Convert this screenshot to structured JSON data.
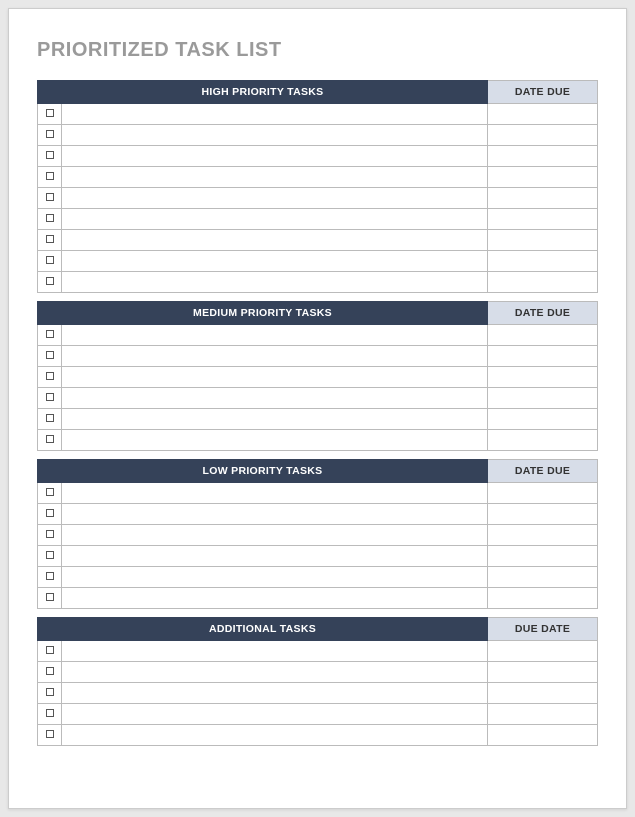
{
  "title": "PRIORITIZED TASK LIST",
  "sections": [
    {
      "header_tasks": "HIGH PRIORITY TASKS",
      "header_date": "DATE DUE",
      "rows": [
        "",
        "",
        "",
        "",
        "",
        "",
        "",
        "",
        ""
      ]
    },
    {
      "header_tasks": "MEDIUM PRIORITY TASKS",
      "header_date": "DATE DUE",
      "rows": [
        "",
        "",
        "",
        "",
        "",
        ""
      ]
    },
    {
      "header_tasks": "LOW PRIORITY TASKS",
      "header_date": "DATE DUE",
      "rows": [
        "",
        "",
        "",
        "",
        "",
        ""
      ]
    },
    {
      "header_tasks": "ADDITIONAL TASKS",
      "header_date": "DUE DATE",
      "rows": [
        "",
        "",
        "",
        "",
        ""
      ]
    }
  ]
}
